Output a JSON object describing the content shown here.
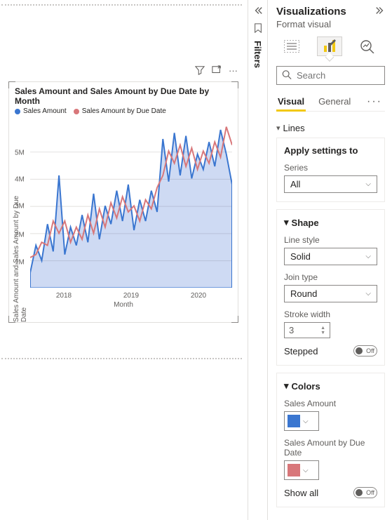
{
  "filters_rail": {
    "label": "Filters"
  },
  "visual_toolbar": {
    "more": "···"
  },
  "chart": {
    "title": "Sales Amount and Sales Amount by Due Date by Month",
    "legend": [
      {
        "label": "Sales Amount",
        "color": "#3a76d0"
      },
      {
        "label": "Sales Amount by Due Date",
        "color": "#d8777a"
      }
    ],
    "y_label": "Sales Amount and Sales Amount by Due Date",
    "y_ticks": [
      "1M",
      "2M",
      "3M",
      "4M",
      "5M"
    ],
    "x_ticks": [
      "2018",
      "2019",
      "2020"
    ],
    "x_label": "Month"
  },
  "chart_data": {
    "type": "line",
    "title": "Sales Amount and Sales Amount by Due Date by Month",
    "xlabel": "Month",
    "ylabel": "Sales Amount and Sales Amount by Due Date",
    "ylim": [
      0,
      5500000
    ],
    "x": [
      "2017-07",
      "2017-08",
      "2017-09",
      "2017-10",
      "2017-11",
      "2017-12",
      "2018-01",
      "2018-02",
      "2018-03",
      "2018-04",
      "2018-05",
      "2018-06",
      "2018-07",
      "2018-08",
      "2018-09",
      "2018-10",
      "2018-11",
      "2018-12",
      "2019-01",
      "2019-02",
      "2019-03",
      "2019-04",
      "2019-05",
      "2019-06",
      "2019-07",
      "2019-08",
      "2019-09",
      "2019-10",
      "2019-11",
      "2019-12",
      "2020-01",
      "2020-02",
      "2020-03",
      "2020-04",
      "2020-05",
      "2020-06"
    ],
    "series": [
      {
        "name": "Sales Amount",
        "color": "#3a76d0",
        "values": [
          500000,
          1400000,
          900000,
          2100000,
          1200000,
          3700000,
          1100000,
          2000000,
          1400000,
          2400000,
          1500000,
          3100000,
          1600000,
          2700000,
          2100000,
          3200000,
          2200000,
          3400000,
          1900000,
          2900000,
          2200000,
          3200000,
          2500000,
          4900000,
          3500000,
          5100000,
          3700000,
          5000000,
          3600000,
          4400000,
          3900000,
          4800000,
          4000000,
          5200000,
          4400000,
          3400000
        ]
      },
      {
        "name": "Sales Amount by Due Date",
        "color": "#d8777a",
        "values": [
          1000000,
          1100000,
          1500000,
          1400000,
          2200000,
          1800000,
          2200000,
          1500000,
          2000000,
          1600000,
          2400000,
          1800000,
          2600000,
          2000000,
          2800000,
          2300000,
          3000000,
          2500000,
          2700000,
          2200000,
          2900000,
          2600000,
          3300000,
          3700000,
          4500000,
          4100000,
          4700000,
          4000000,
          4600000,
          3900000,
          4500000,
          4100000,
          4800000,
          4300000,
          5300000,
          4700000
        ]
      }
    ]
  },
  "pane": {
    "title": "Visualizations",
    "subtitle": "Format visual",
    "search_placeholder": "Search",
    "tabs": {
      "visual": "Visual",
      "general": "General",
      "more": "···"
    },
    "sections": {
      "lines": {
        "label": "Lines"
      },
      "apply": {
        "title": "Apply settings to",
        "series_label": "Series",
        "series_value": "All"
      },
      "shape": {
        "label": "Shape",
        "line_style_label": "Line style",
        "line_style_value": "Solid",
        "join_type_label": "Join type",
        "join_type_value": "Round",
        "stroke_width_label": "Stroke width",
        "stroke_width_value": "3",
        "stepped_label": "Stepped",
        "stepped_value": "Off"
      },
      "colors": {
        "label": "Colors",
        "series": [
          {
            "label": "Sales Amount",
            "color": "#3a76d0"
          },
          {
            "label": "Sales Amount by Due Date",
            "color": "#d8777a"
          }
        ],
        "show_all_label": "Show all",
        "show_all_value": "Off"
      }
    }
  }
}
